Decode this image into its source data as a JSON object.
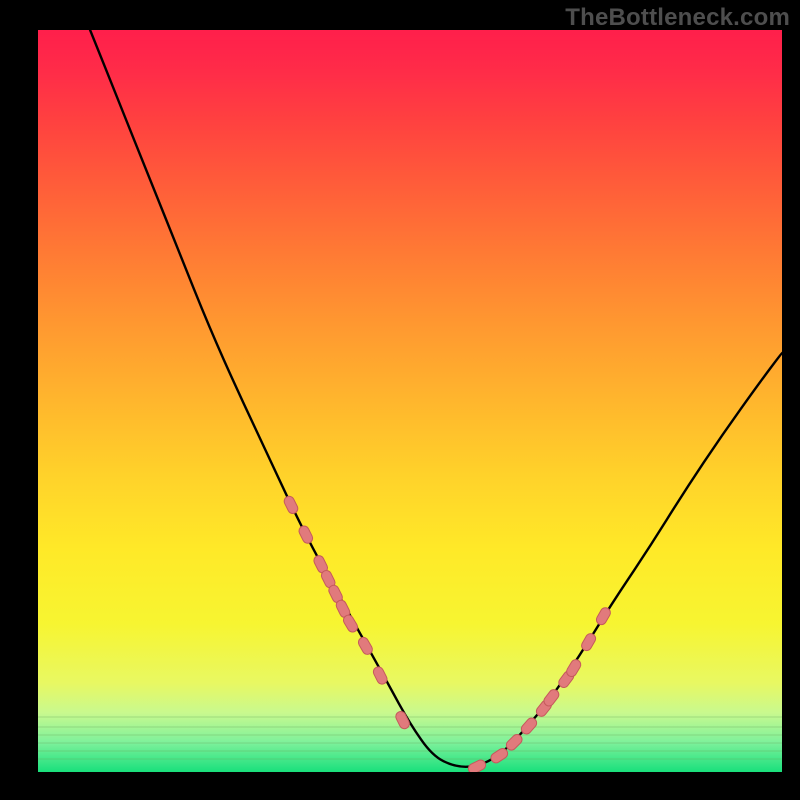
{
  "watermark": "TheBottleneck.com",
  "colors": {
    "frame": "#000000",
    "curve": "#000000",
    "markerFill": "#e17a7c",
    "markerStroke": "#c55a5c",
    "gradient_top": "#ff1f4b",
    "gradient_bottom": "#19e07c"
  },
  "chart_data": {
    "type": "line",
    "title": "",
    "xlabel": "",
    "ylabel": "",
    "xlim": [
      0,
      100
    ],
    "ylim": [
      0,
      100
    ],
    "grid": false,
    "legend": false,
    "annotations": [
      "TheBottleneck.com"
    ],
    "series": [
      {
        "name": "bottleneck-curve",
        "x": [
          7,
          11,
          15,
          19,
          23,
          27,
          31,
          34,
          37,
          39.5,
          42,
          44.5,
          47,
          50,
          53,
          56,
          59,
          62,
          65,
          69,
          73,
          77,
          82,
          87,
          92,
          97,
          100
        ],
        "y": [
          100,
          90,
          80,
          70,
          60,
          51,
          42.5,
          36,
          30,
          25.5,
          21,
          16.5,
          12,
          6.5,
          2.2,
          0.7,
          0.7,
          2.2,
          5.2,
          10,
          16,
          22.5,
          30,
          38,
          45.5,
          52.5,
          56.5
        ]
      }
    ],
    "markers": {
      "name": "sample-points",
      "style": "pill",
      "x_left": [
        34,
        36,
        38,
        39,
        40,
        41,
        42,
        44,
        46,
        49
      ],
      "y_left": [
        36,
        32,
        28,
        26,
        24,
        22,
        20,
        17,
        13,
        7
      ],
      "x_right": [
        59,
        62,
        64,
        66,
        68,
        69,
        71,
        72,
        74,
        76
      ],
      "y_right": [
        0.7,
        2.2,
        4,
        6.2,
        8.6,
        10,
        12.5,
        14,
        17.5,
        21
      ]
    }
  }
}
